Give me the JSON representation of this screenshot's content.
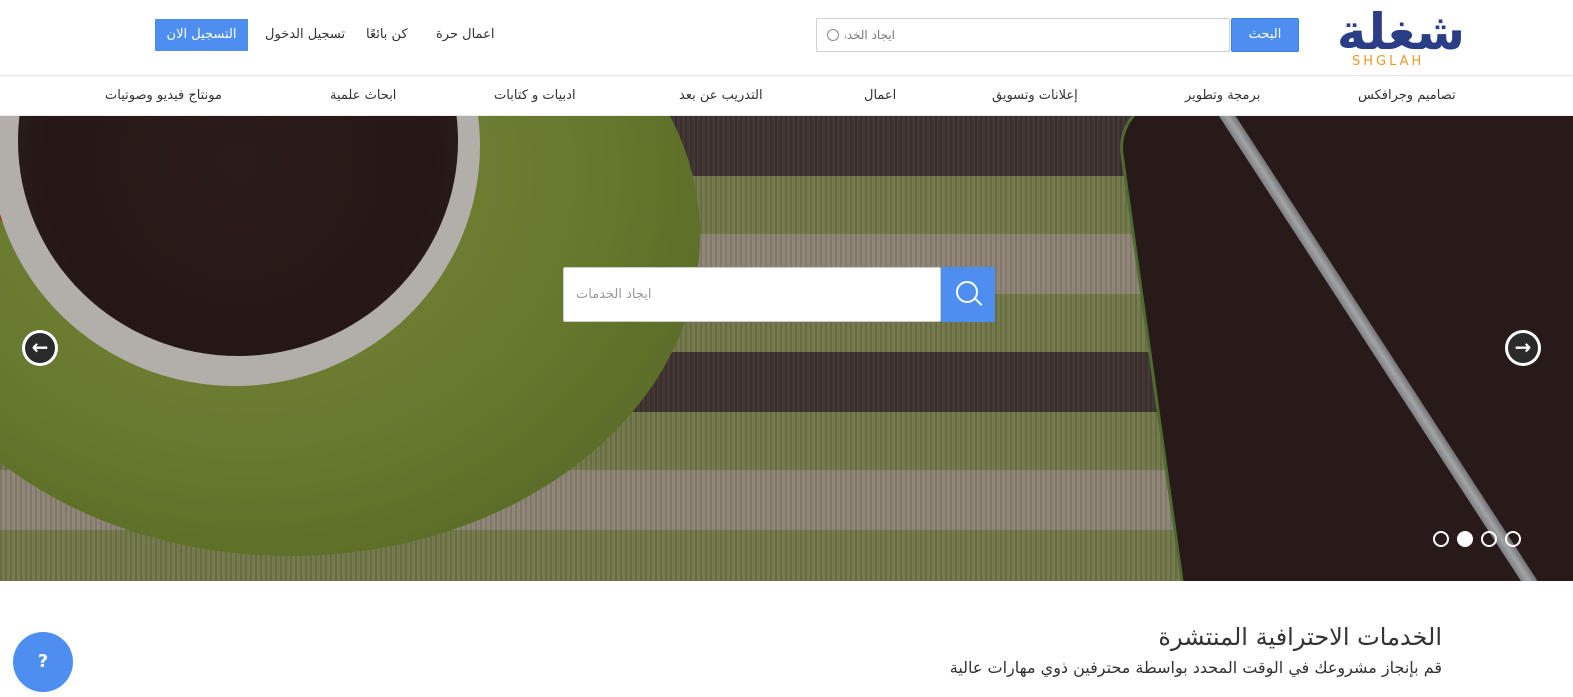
{
  "brand": {
    "logo_ar": "شغلة",
    "logo_en": "SHGLAH"
  },
  "header": {
    "search_button_label": "البحث",
    "search_placeholder": "ايجاد الخدمات",
    "links": {
      "freelance": "اعمال حرة",
      "become_seller": "كن بائعًا",
      "login": "تسجيل الدخول",
      "register": "التسجيل الان"
    }
  },
  "categories": [
    "تصاميم وجرافكس",
    "برمجة وتطوير",
    "إعلانات وتسويق",
    "اعمال",
    "التدريب عن بعد",
    "ادبيات و كتابات",
    "ابحاث علمية",
    "مونتاج فيديو وصوتيات"
  ],
  "hero": {
    "search_placeholder": "ايجاد الخدمات",
    "prev_icon": "arrow-left-circle-icon",
    "next_icon": "arrow-right-circle-icon",
    "slide_count": 4,
    "active_slide": 2
  },
  "section": {
    "title": "الخدمات الاحترافية المنتشرة",
    "subtitle": "قم بإنجاز مشروعك في الوقت المحدد بواسطة محترفين ذوي مهارات عالية"
  },
  "help": {
    "label": "?"
  },
  "colors": {
    "accent": "#4d8ef0",
    "logo_primary": "#2a3e86",
    "logo_secondary": "#e89a2b"
  }
}
